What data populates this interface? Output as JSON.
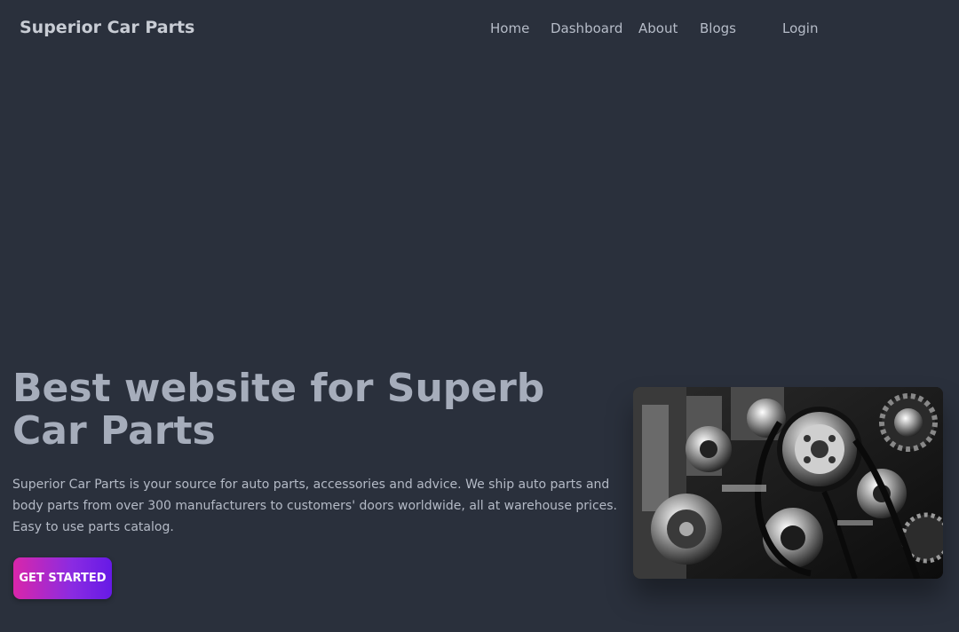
{
  "navbar": {
    "brand": "Superior Car Parts",
    "links": [
      {
        "label": "Home"
      },
      {
        "label": "Dashboard"
      },
      {
        "label": "About"
      },
      {
        "label": "Blogs"
      },
      {
        "label": "Login"
      }
    ]
  },
  "hero": {
    "title": "Best website for Superb Car Parts",
    "description": "Superior Car Parts is your source for auto parts, accessories and advice. We ship auto parts and body parts from over 300 manufacturers to customers' doors worldwide, all at warehouse prices. Easy to use parts catalog.",
    "cta_label": "GET STARTED",
    "image": {
      "icon": "engine-photo"
    }
  },
  "colors": {
    "background": "#2a303c",
    "text": "#a6adbb",
    "cta_gradient_start": "#d926aa",
    "cta_gradient_end": "#661ae6"
  }
}
